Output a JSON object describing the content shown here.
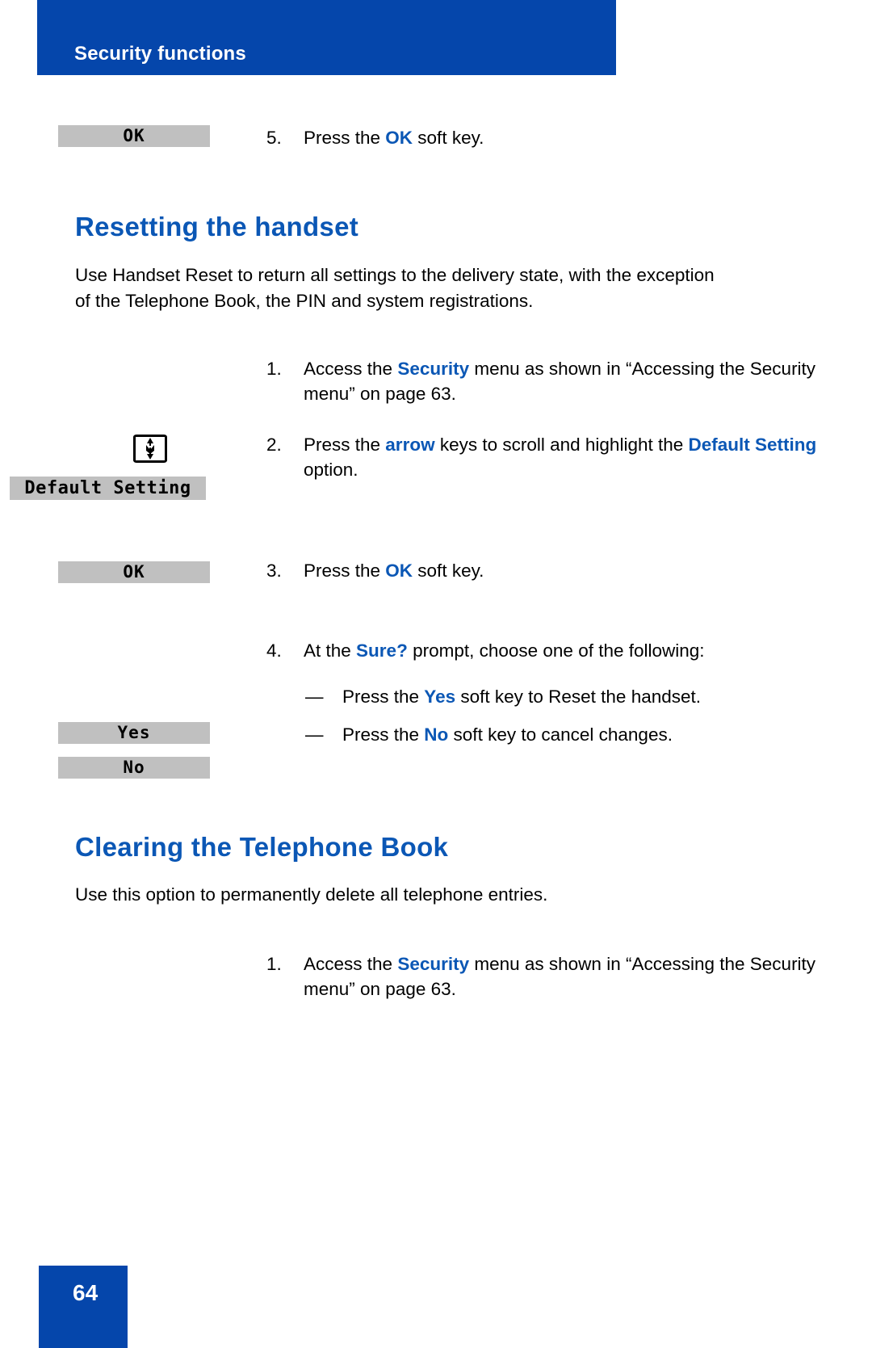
{
  "header": {
    "title": "Security functions",
    "banner_color": "#0546ab"
  },
  "colors": {
    "accent_blue": "#0b57b5",
    "banner_blue": "#0546ab",
    "lcd_gray": "#c0c0c0"
  },
  "top_step": {
    "number": "5.",
    "text_before": "Press the ",
    "keyword": "OK",
    "text_after": " soft key.",
    "softkey_label": "OK"
  },
  "sections": [
    {
      "heading": "Resetting the handset",
      "intro": "Use Handset Reset to return all settings to the delivery state, with the exception of the Telephone Book, the PIN and system registrations.",
      "steps": [
        {
          "number": "1.",
          "text_before": "Access the ",
          "keyword": "Security",
          "text_after": " menu as shown in “Accessing the Security menu” on page 63."
        },
        {
          "number": "2.",
          "text_before": "Press the ",
          "keyword": "arrow",
          "text_mid": " keys to scroll and highlight the ",
          "keyword2": "Default Setting",
          "text_after": " option.",
          "icon": "nav-arrow-key-icon",
          "lcd_label": "Default Setting"
        },
        {
          "number": "3.",
          "text_before": "Press the ",
          "keyword": "OK",
          "text_after": " soft key.",
          "softkey_label": "OK"
        },
        {
          "number": "4.",
          "text_before": "At the ",
          "keyword": "Sure?",
          "text_after": " prompt, choose one of the following:",
          "sub_items": [
            {
              "mark": "—",
              "text_before": "Press the ",
              "keyword": "Yes",
              "text_after": " soft key to Reset the handset.",
              "softkey_label": "Yes"
            },
            {
              "mark": "—",
              "text_before": "Press the ",
              "keyword": "No",
              "text_after": " soft key to cancel changes.",
              "softkey_label": "No"
            }
          ]
        }
      ]
    },
    {
      "heading": "Clearing the Telephone Book",
      "intro": "Use this option to permanently delete all telephone entries.",
      "steps": [
        {
          "number": "1.",
          "text_before": "Access the ",
          "keyword": "Security",
          "text_after": " menu as shown in “Accessing the Security menu” on page 63."
        }
      ]
    }
  ],
  "footer": {
    "page_number": "64"
  }
}
